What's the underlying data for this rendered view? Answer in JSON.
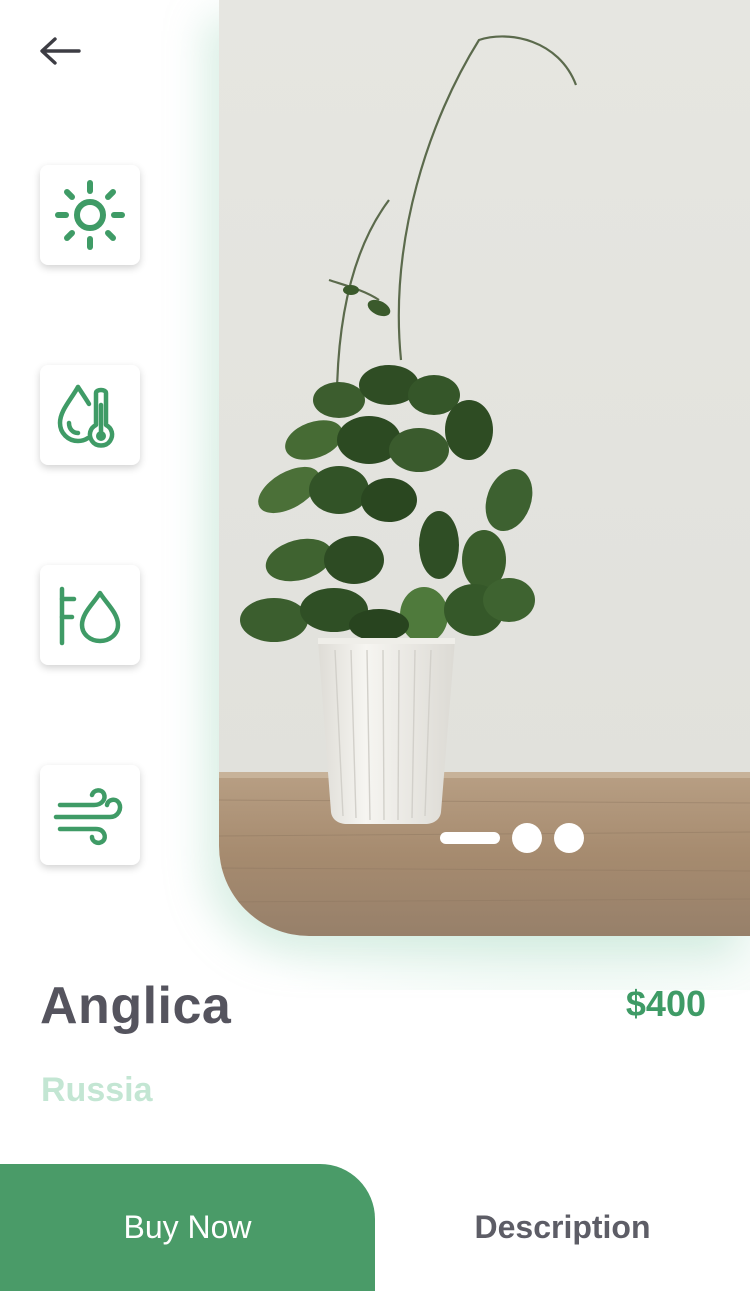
{
  "header": {
    "back_icon": "arrow-left-icon"
  },
  "features": [
    {
      "icon": "sun-icon"
    },
    {
      "icon": "humidity-temperature-icon"
    },
    {
      "icon": "water-level-icon"
    },
    {
      "icon": "wind-icon"
    }
  ],
  "product": {
    "name": "Anglica",
    "price": "$400",
    "origin": "Russia"
  },
  "carousel": {
    "slides": 3,
    "active_index": 0
  },
  "actions": {
    "buy_label": "Buy Now",
    "description_label": "Description"
  },
  "colors": {
    "accent": "#4a9b68",
    "price": "#3f9b66",
    "origin": "#c3e6d3",
    "title": "#55545e"
  }
}
